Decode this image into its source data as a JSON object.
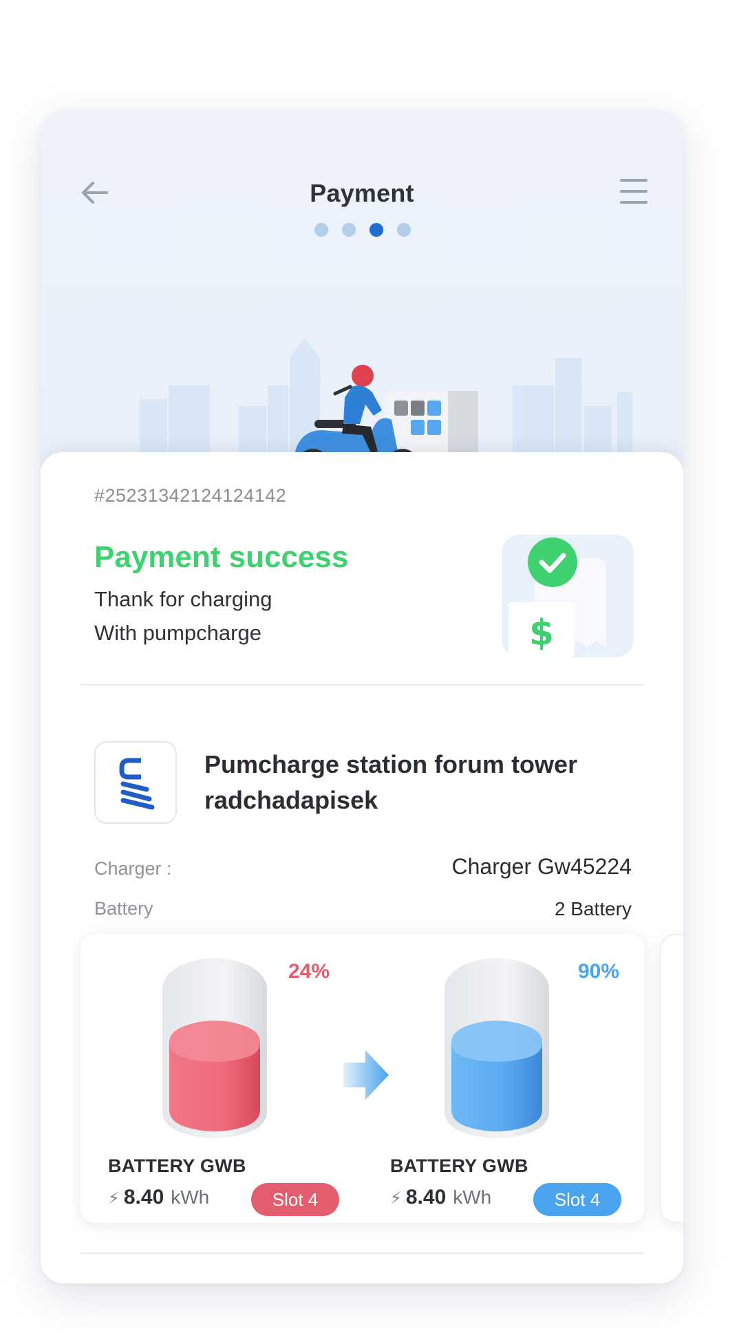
{
  "header": {
    "title": "Payment",
    "steps": 4,
    "active_step": 3
  },
  "order": {
    "id": "#25231342124124142",
    "status_title": "Payment success",
    "message_line1": "Thank for charging",
    "message_line2": "With pumpcharge"
  },
  "station": {
    "name": "Pumcharge station forum tower radchadapisek",
    "charger_label": "Charger :",
    "charger_value": "Charger Gw45224",
    "battery_label": "Battery",
    "battery_value": "2 Battery"
  },
  "batteries": [
    {
      "percent": "24%",
      "level": 0.24,
      "name": "BATTERY GWB",
      "energy_value": "8.40",
      "energy_unit": "kWh",
      "slot": "Slot 4",
      "color": "#e45d6e"
    },
    {
      "percent": "90%",
      "level": 0.9,
      "name": "BATTERY GWB",
      "energy_value": "8.40",
      "energy_unit": "kWh",
      "slot": "Slot 4",
      "color": "#4aa3ee"
    }
  ],
  "colors": {
    "accent": "#1f6fd1",
    "success": "#3fd16f",
    "low_battery": "#e45d6e",
    "high_battery": "#4aa3ee"
  },
  "icons": {
    "back": "arrow-left-icon",
    "menu": "hamburger-menu-icon",
    "energy": "lightning-bolt-icon",
    "swap": "arrow-right-icon"
  }
}
